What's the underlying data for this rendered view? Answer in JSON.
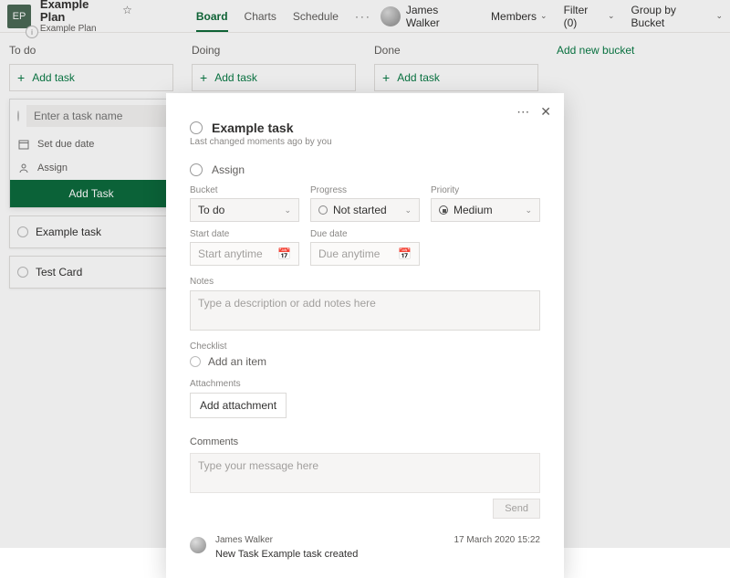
{
  "plan": {
    "initials": "EP",
    "title": "Example Plan",
    "breadcrumb": "Example Plan"
  },
  "tabs": {
    "board": "Board",
    "charts": "Charts",
    "schedule": "Schedule",
    "more": "···"
  },
  "topbar": {
    "user_name": "James Walker",
    "members": "Members",
    "filter": "Filter (0)",
    "group_by": "Group by Bucket"
  },
  "buckets": {
    "todo": {
      "title": "To do",
      "add_task": "Add task"
    },
    "doing": {
      "title": "Doing",
      "add_task": "Add task"
    },
    "done": {
      "title": "Done",
      "add_task": "Add task"
    },
    "add_new": "Add new bucket"
  },
  "newtask": {
    "placeholder": "Enter a task name",
    "set_due_date": "Set due date",
    "assign": "Assign",
    "add_button": "Add Task"
  },
  "cards": {
    "c0": "Example task",
    "c1": "Test Card"
  },
  "swatch_colors": [
    "#f7c1cd",
    "#f5c3b6",
    "#f3e2a8",
    "#c2e5bb",
    "#b9d9f0",
    "#d8c7ec"
  ],
  "modal": {
    "task_title": "Example task",
    "last_changed": "Last changed moments ago by you",
    "assign_label": "Assign",
    "bucket": {
      "label": "Bucket",
      "value": "To do"
    },
    "progress": {
      "label": "Progress",
      "value": "Not started"
    },
    "priority": {
      "label": "Priority",
      "value": "Medium"
    },
    "start_date": {
      "label": "Start date",
      "placeholder": "Start anytime"
    },
    "due_date": {
      "label": "Due date",
      "placeholder": "Due anytime"
    },
    "notes": {
      "label": "Notes",
      "placeholder": "Type a description or add notes here"
    },
    "checklist": {
      "label": "Checklist",
      "add_item": "Add an item"
    },
    "attachments": {
      "label": "Attachments",
      "button": "Add attachment"
    },
    "comments": {
      "label": "Comments",
      "placeholder": "Type your message here",
      "send": "Send"
    },
    "activity": {
      "author": "James Walker",
      "timestamp": "17 March 2020 15:22",
      "message": "New Task Example task created"
    }
  }
}
